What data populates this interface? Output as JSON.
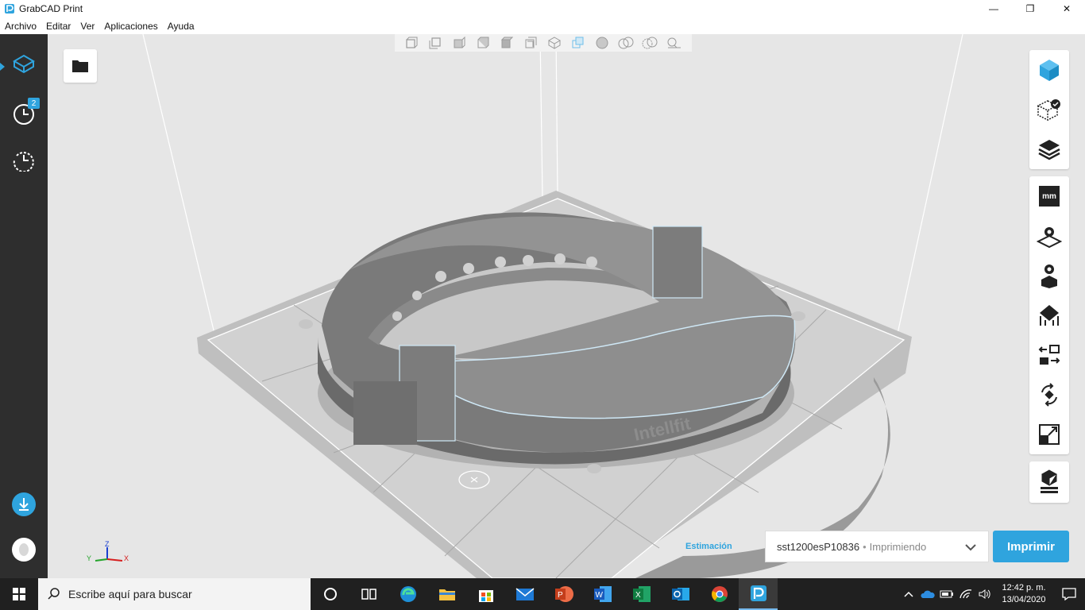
{
  "window": {
    "title": "GrabCAD Print",
    "minimize": "—",
    "maximize": "❐",
    "close": "✕"
  },
  "menu": [
    "Archivo",
    "Editar",
    "Ver",
    "Aplicaciones",
    "Ayuda"
  ],
  "leftbar": {
    "items": [
      {
        "icon": "model-cube-icon"
      },
      {
        "icon": "print-queue-clock-icon",
        "badge": "2"
      },
      {
        "icon": "history-icon"
      }
    ],
    "bottom": [
      {
        "icon": "download-icon"
      },
      {
        "icon": "avatar"
      }
    ]
  },
  "viewport": {
    "view_tools": [
      "view-front-icon",
      "view-back-icon",
      "view-left-icon",
      "view-right-icon",
      "view-top-icon",
      "view-bottom-icon",
      "view-iso-icon",
      "view-fit-icon",
      "shading-icon",
      "section-view-icon",
      "exploded-view-icon",
      "inspect-icon"
    ],
    "axis": {
      "x": "X",
      "y": "Y",
      "z": "Z"
    },
    "model_text": "Intellfit"
  },
  "right_panel": {
    "group1": [
      "model-view-icon",
      "check-part-icon",
      "layers-icon"
    ],
    "group2": [
      "units-mm-icon",
      "tray-settings-icon",
      "model-settings-icon",
      "orientation-icon",
      "move-icon",
      "rotate-icon",
      "scale-icon"
    ],
    "group3": [
      "part-list-icon"
    ],
    "units_label": "mm"
  },
  "footer": {
    "estimation_label": "Estimación",
    "printer_name": "sst1200esP10836",
    "separator": "•",
    "printer_status": "Imprimiendo",
    "print_button": "Imprimir"
  },
  "taskbar": {
    "search_placeholder": "Escribe aquí para buscar",
    "apps": [
      "cortana-icon",
      "task-view-icon",
      "edge-icon",
      "file-explorer-icon",
      "store-icon",
      "mail-icon",
      "powerpoint-icon",
      "word-icon",
      "excel-icon",
      "outlook-icon",
      "chrome-icon",
      "grabcad-icon"
    ],
    "time": "12:42 p. m.",
    "date": "13/04/2020"
  },
  "colors": {
    "accent": "#2fa4de",
    "sidebar": "#2e2e2e",
    "viewport": "#e6e6e6",
    "model": "#8c8c8c"
  }
}
